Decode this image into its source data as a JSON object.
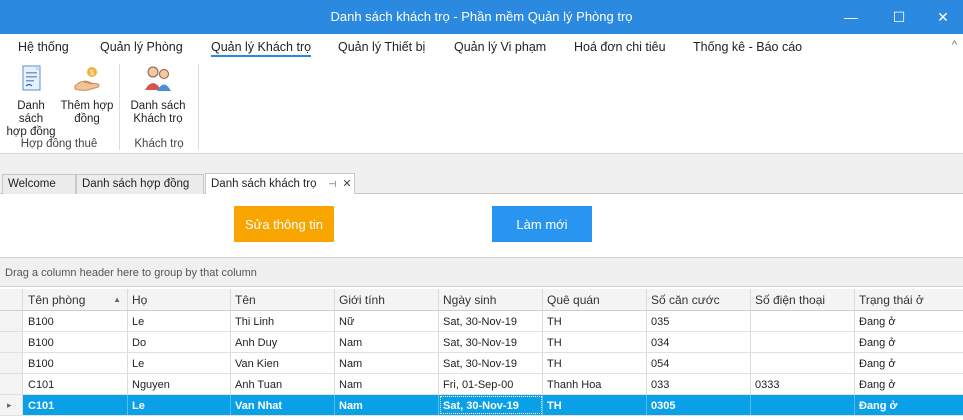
{
  "window": {
    "title": "Danh sách khách trọ - Phần mềm Quản lý Phòng trọ",
    "minimize": "—",
    "maximize": "☐",
    "close": "✕"
  },
  "ribbon": {
    "tabs": [
      {
        "label": "Hệ thống"
      },
      {
        "label": "Quản lý Phòng"
      },
      {
        "label": "Quản lý Khách trọ"
      },
      {
        "label": "Quản lý Thiết bị"
      },
      {
        "label": "Quản lý Vi phạm"
      },
      {
        "label": "Hoá đơn chi tiêu"
      },
      {
        "label": "Thống kê - Báo cáo"
      }
    ],
    "collapse_icon": "^",
    "groups": [
      {
        "label": "Hợp đồng thuê",
        "buttons": [
          {
            "line1": "Danh sách",
            "line2": "hợp đồng",
            "icon": "contract-list-icon"
          },
          {
            "line1": "Thêm hợp",
            "line2": "đồng",
            "icon": "add-contract-icon"
          }
        ]
      },
      {
        "label": "Khách trọ",
        "buttons": [
          {
            "line1": "Danh sách",
            "line2": "Khách trọ",
            "icon": "tenants-icon"
          }
        ]
      }
    ]
  },
  "doc_tabs": [
    {
      "label": "Welcome"
    },
    {
      "label": "Danh sách hợp đồng"
    },
    {
      "label": "Danh sách khách trọ",
      "pin": "⊣",
      "close": "✕"
    }
  ],
  "actions": {
    "edit_label": "Sửa thông tin",
    "refresh_label": "Làm mới"
  },
  "grid": {
    "group_hint": "Drag a column header here to group by that column",
    "sort_icon": "▲",
    "current_row_icon": "▸",
    "columns": [
      "Tên phòng",
      "Họ",
      "Tên",
      "Giới tính",
      "Ngày sinh",
      "Quê quán",
      "Số căn cước",
      "Số điện thoại",
      "Trạng thái ở"
    ],
    "rows": [
      [
        "B100",
        "Le",
        "Thi Linh",
        "Nữ",
        "Sat, 30-Nov-19",
        "TH",
        "035",
        "",
        "Đang ở"
      ],
      [
        "B100",
        "Do",
        "Anh Duy",
        "Nam",
        "Sat, 30-Nov-19",
        "TH",
        "034",
        "",
        "Đang ở"
      ],
      [
        "B100",
        "Le",
        "Van Kien",
        "Nam",
        "Sat, 30-Nov-19",
        "TH",
        "054",
        "",
        "Đang ở"
      ],
      [
        "C101",
        "Nguyen",
        "Anh Tuan",
        "Nam",
        "Fri, 01-Sep-00",
        "Thanh Hoa",
        "033",
        "0333",
        "Đang ở"
      ],
      [
        "C101",
        "Le",
        "Van Nhat",
        "Nam",
        "Sat, 30-Nov-19",
        "TH",
        "0305",
        "",
        "Đang ở"
      ]
    ]
  },
  "colors": {
    "titlebar": "#2b8ae0",
    "edit_button": "#f8a500",
    "refresh_button": "#2a95f0",
    "selected_row": "#0aa0e8"
  }
}
